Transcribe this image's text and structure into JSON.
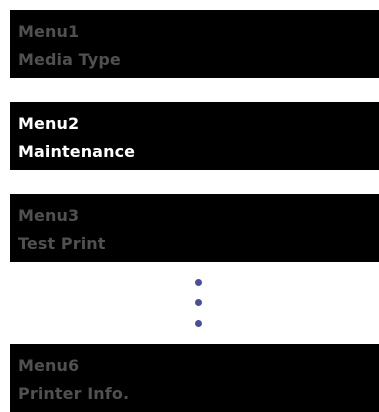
{
  "menus": [
    {
      "title": "Menu1",
      "label": "Media Type"
    },
    {
      "title": "Menu2",
      "label": "Maintenance"
    },
    {
      "title": "Menu3",
      "label": "Test Print"
    },
    {
      "title": "Menu6",
      "label": "Printer Info."
    }
  ],
  "selected_menu": "Menu2",
  "colors": {
    "background": "#000000",
    "selected_text": "#ffffff",
    "dim_text": "#505050",
    "ellipsis_dots": "#4a4f9c"
  }
}
